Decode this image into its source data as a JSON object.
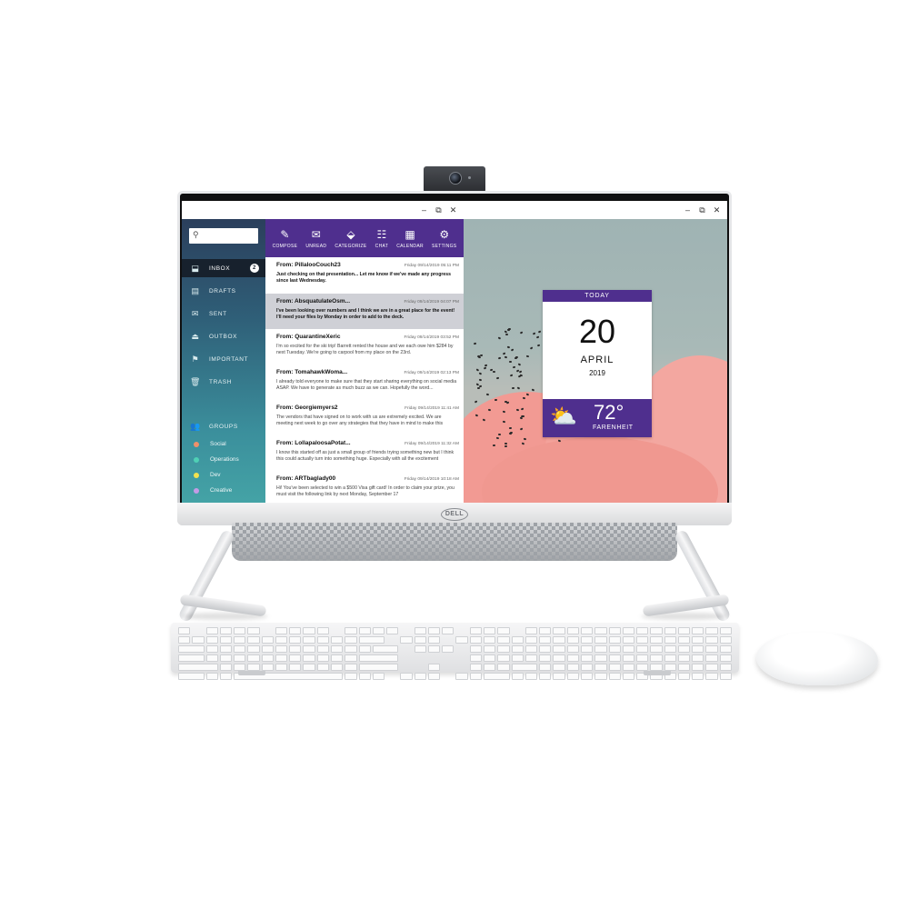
{
  "mail": {
    "search": {
      "value": "",
      "placeholder": ""
    },
    "nav": [
      {
        "label": "INBOX",
        "icon": "inbox-icon",
        "badge": "2"
      },
      {
        "label": "DRAFTS",
        "icon": "drafts-icon"
      },
      {
        "label": "SENT",
        "icon": "sent-icon"
      },
      {
        "label": "OUTBOX",
        "icon": "outbox-icon"
      },
      {
        "label": "IMPORTANT",
        "icon": "flag-icon"
      },
      {
        "label": "TRASH",
        "icon": "trash-icon"
      }
    ],
    "groups_label": "GROUPS",
    "groups": [
      {
        "label": "Social",
        "color": "#f0906a"
      },
      {
        "label": "Operations",
        "color": "#4fd0b5"
      },
      {
        "label": "Dev",
        "color": "#f2e24e"
      },
      {
        "label": "Creative",
        "color": "#c39be6"
      }
    ],
    "toolbar": [
      {
        "label": "COMPOSE",
        "icon": "pen-icon"
      },
      {
        "label": "UNREAD",
        "icon": "envelope-icon"
      },
      {
        "label": "CATEGORIZE",
        "icon": "tag-icon"
      },
      {
        "label": "CHAT",
        "icon": "chat-icon"
      },
      {
        "label": "CALENDAR",
        "icon": "calendar-icon"
      },
      {
        "label": "SETTINGS",
        "icon": "gear-icon"
      }
    ],
    "messages": [
      {
        "from": "From: PillalooCouch23",
        "date": "Friday 09/14/2019 05:11 PM",
        "preview": "Just checking on that presentation... Let me know if we've made any progress since last Wednesday.",
        "bold": true
      },
      {
        "from": "From: AbsquatulateOsm...",
        "date": "Friday 09/14/2019 04:07 PM",
        "preview": "I've been looking over numbers and I think we are in a great place for the event! I'll need your files by Monday in order to add to the deck.",
        "bold": true
      },
      {
        "from": "From: QuarantineXeric",
        "date": "Friday 09/14/2019 03:52 PM",
        "preview": "I'm so excited for the ski trip! Barrett rented the house and we each owe him $284 by next Tuesday. We're going to carpool from my place on the 23rd."
      },
      {
        "from": "From: TomahawkWoma...",
        "date": "Friday 09/14/2019 02:13 PM",
        "preview": "I already told everyone to make sure that they start sharing everything on social media ASAP. We have to generate as much buzz as we can. Hopefully the word..."
      },
      {
        "from": "From: Georgiemyers2",
        "date": "Friday 09/14/2019 11:41 AM",
        "preview": "The vendors that have signed on to work with us are extremely excited. We are meeting next week to go over any strategies that they have in mind to make this"
      },
      {
        "from": "From: LollapaloosaPotat...",
        "date": "Friday 09/14/2019 11:32 AM",
        "preview": "I know this started off as just a small group of friends trying something new but I think this could actually turn into something huge. Especially with all the excitement"
      },
      {
        "from": "From: ARTbaglady00",
        "date": "Friday 09/14/2019 10:18 AM",
        "preview": "Hi! You've been selected to win a $500 Visa gift card! In order to claim your prize, you must visit the following link by next Monday, September 17"
      }
    ]
  },
  "widget": {
    "header": "TODAY",
    "day": "20",
    "month": "APRIL",
    "year": "2019",
    "temperature": "72°",
    "unit": "FARENHEIT",
    "weather_icon": "partly-cloudy-icon"
  },
  "window_controls": {
    "minimize": "–",
    "restore": "⧉",
    "close": "✕"
  },
  "brand": "DELL",
  "colors": {
    "accent": "#4f2f8e",
    "sidebar_dark": "#17212d"
  }
}
